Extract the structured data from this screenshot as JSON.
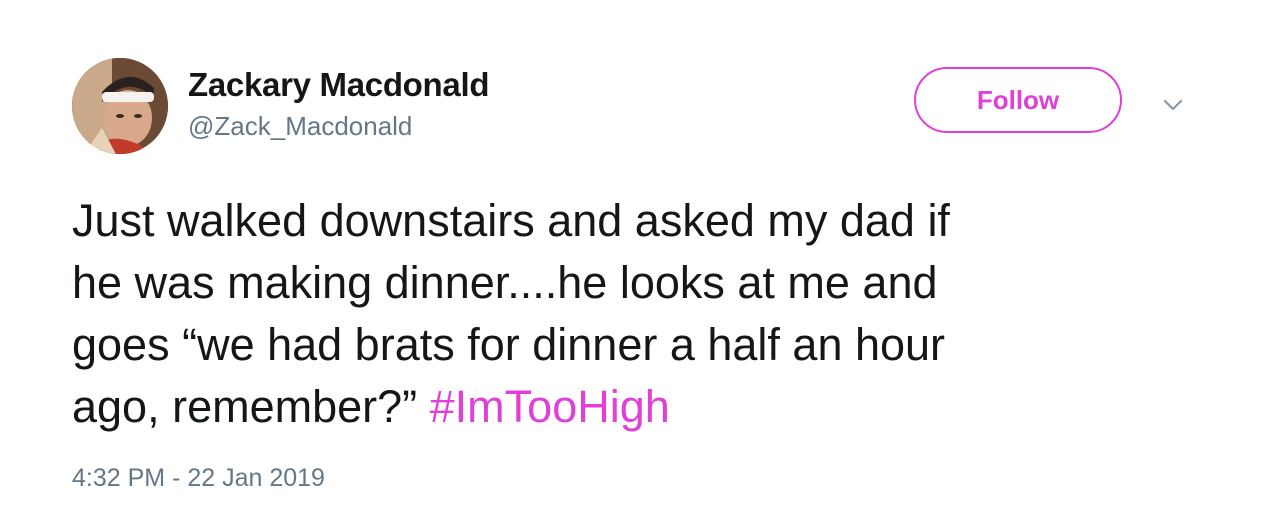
{
  "tweet": {
    "author": {
      "display_name": "Zackary Macdonald",
      "handle": "@Zack_Macdonald",
      "avatar_icon": "profile-photo"
    },
    "follow_label": "Follow",
    "menu_icon": "chevron-down-icon",
    "text_lines": [
      "Just walked downstairs and asked my dad if",
      "he was making dinner....he looks at me and",
      "goes “we had brats for dinner a half an hour",
      "ago, remember?” "
    ],
    "hashtag": "#ImTooHigh",
    "timestamp": "4:32 PM - 22 Jan 2019"
  },
  "colors": {
    "accent": "#e040d8",
    "text": "#14171a",
    "secondary_text": "#657786"
  }
}
